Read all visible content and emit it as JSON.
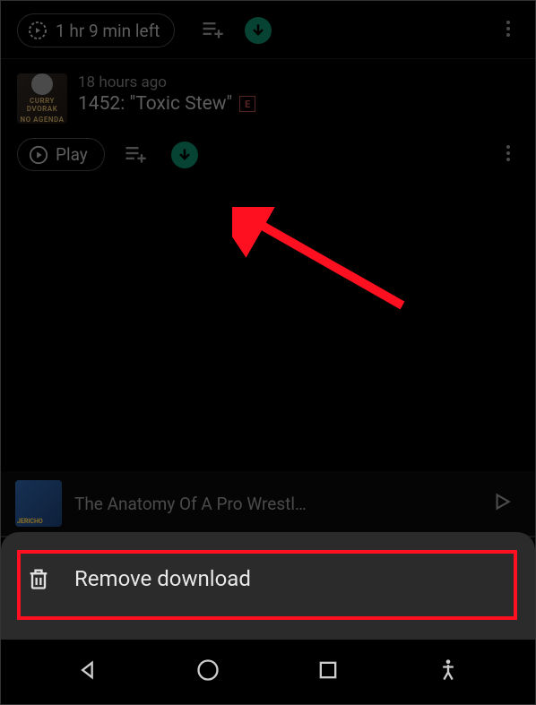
{
  "row1": {
    "time_left": "1 hr 9 min left"
  },
  "episode": {
    "timestamp": "18 hours ago",
    "title": "1452: \"Toxic Stew\"",
    "explicit_label": "E",
    "artwork_text_top": "CURRY DVORAK",
    "artwork_text_bottom": "NO AGENDA"
  },
  "row2": {
    "play_label": "Play"
  },
  "now_playing": {
    "title": "The Anatomy Of A Pro Wrestl…"
  },
  "sheet": {
    "remove_label": "Remove download"
  }
}
